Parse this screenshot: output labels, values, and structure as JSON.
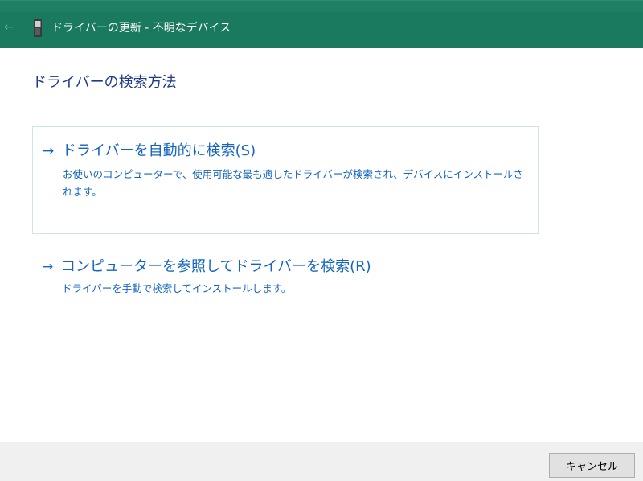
{
  "window": {
    "title": "ドライバーの更新 - 不明なデバイス",
    "back_icon": "left-arrow-icon",
    "device_icon": "device-icon",
    "titlebar_color": "#1a7a60"
  },
  "main": {
    "heading": "ドライバーの検索方法",
    "options": [
      {
        "title": "ドライバーを自動的に検索(S)",
        "description": "お使いのコンピューターで、使用可能な最も適したドライバーが検索され、デバイスにインストールされます。",
        "icon": "right-arrow-icon"
      },
      {
        "title": "コンピューターを参照してドライバーを検索(R)",
        "description": "ドライバーを手動で検索してインストールします。",
        "icon": "right-arrow-icon"
      }
    ],
    "link_color": "#1565c0"
  },
  "footer": {
    "cancel_label": "キャンセル"
  }
}
